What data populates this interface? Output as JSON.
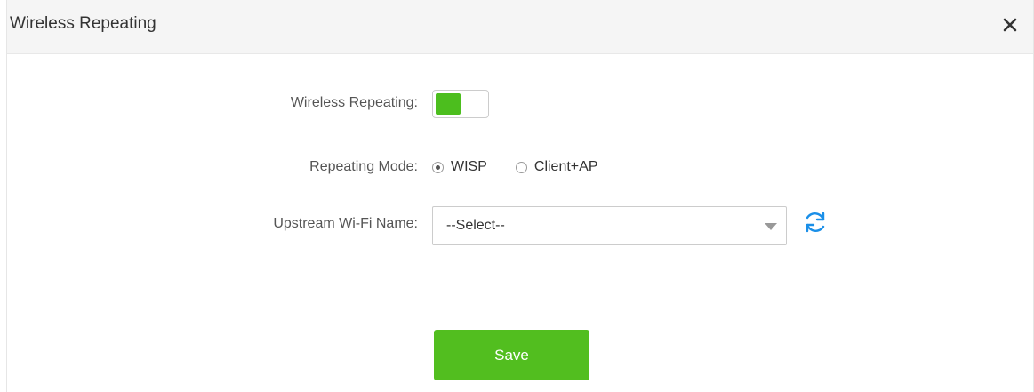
{
  "dialog": {
    "title": "Wireless Repeating",
    "close_icon": "close-icon"
  },
  "form": {
    "wireless_repeating": {
      "label": "Wireless Repeating:",
      "enabled": true,
      "accent": "#4cbe1e"
    },
    "repeating_mode": {
      "label": "Repeating Mode:",
      "options": [
        "WISP",
        "Client+AP"
      ],
      "selected": "WISP"
    },
    "upstream_wifi": {
      "label": "Upstream Wi-Fi Name:",
      "value": "--Select--",
      "refresh_icon": "refresh-icon",
      "refresh_color": "#1a8fe8"
    },
    "save_label": "Save",
    "save_color": "#52be1f"
  }
}
